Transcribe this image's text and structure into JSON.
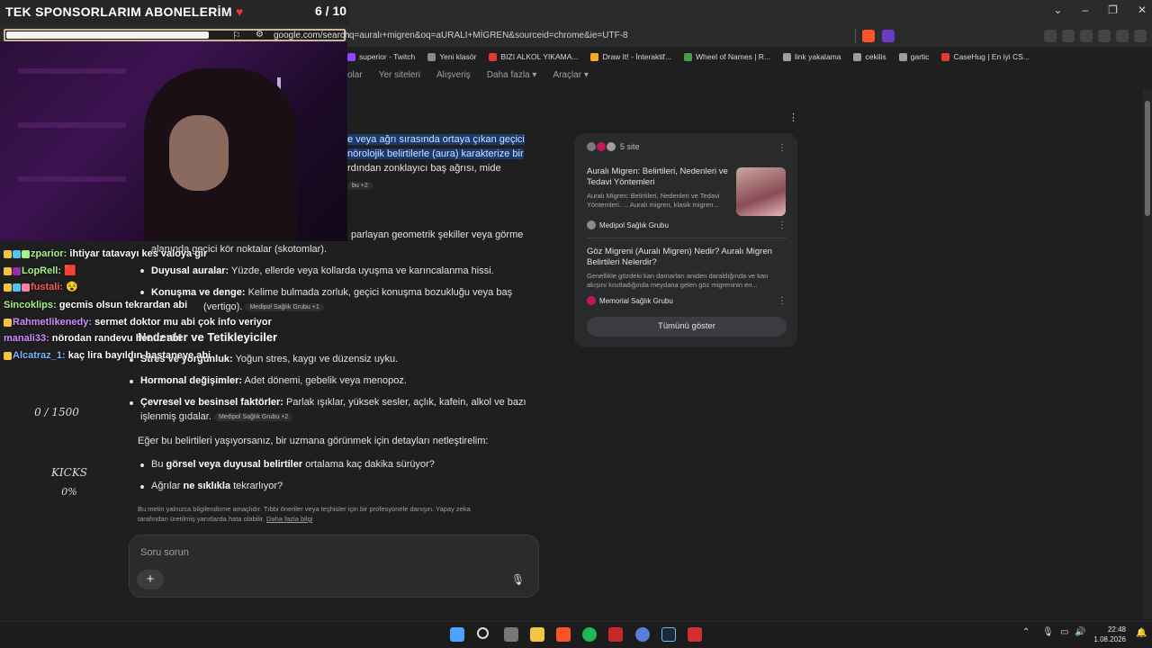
{
  "overlay": {
    "title": "TEK SPONSORLARIM ABONELERİM",
    "heart": "♥",
    "count": "6 / 10",
    "bar_url": "google.com/search",
    "goal_text": "0 / 1500",
    "kicks_label": "KICKS",
    "kicks_value": "0%"
  },
  "browser": {
    "url_rest": "q=auralı+migren&oq=aURALI+MİGREN&sourceid=chrome&ie=UTF-8",
    "bookmarks": [
      {
        "label": "superior - Twitch",
        "color": "#9146ff"
      },
      {
        "label": "Yeni klasör",
        "color": "#8a8a8a"
      },
      {
        "label": "BIZI ALKOL YIKAMA...",
        "color": "#e53935"
      },
      {
        "label": "Draw It! - İnteraktif...",
        "color": "#f9a825"
      },
      {
        "label": "Wheel of Names | R...",
        "color": "#43a047"
      },
      {
        "label": "link yakalama",
        "color": "#9e9e9e"
      },
      {
        "label": "cekilis",
        "color": "#9e9e9e"
      },
      {
        "label": "gartic",
        "color": "#9e9e9e"
      },
      {
        "label": "CaseHug | En iyi CS...",
        "color": "#e53935"
      }
    ],
    "nav": [
      "olar",
      "Yer siteleri",
      "Alışveriş",
      "Daha fazla ▾",
      "Araçlar ▾"
    ]
  },
  "chat": [
    {
      "user": "zparior:",
      "msg": " ihtiyar tatavayı kes valoya gir",
      "color": "#a6f08a"
    },
    {
      "user": "LopRell:",
      "msg": " 🟥",
      "color": "#a6f08a"
    },
    {
      "user": "fustali:",
      "msg": " 😵",
      "color": "#ff5a5a"
    },
    {
      "user": "Sincoklips:",
      "msg": " gecmis olsun tekrardan abi",
      "color": "#a6f08a"
    },
    {
      "user": "Rahmetlikenedy:",
      "msg": " sermet doktor mu abi çok info veriyor",
      "color": "#d38cff"
    },
    {
      "user": "manali33:",
      "msg": " nörodan randevu henüz abi",
      "color": "#d38cff"
    },
    {
      "user": "Alcatraz_1:",
      "msg": " kaç lira bayıldın hastaneye abi",
      "color": "#7fb2ff"
    }
  ],
  "content": {
    "p1_line1": "e veya ağrı sırasında ortaya çıkan geçici",
    "p1_line2": "nörolojik belirtilerle (aura) karakterize bir",
    "p1_line3": "rdından zonklayıcı baş ağrısı, mide",
    "chip1": "bu +2",
    "visual_line1": "parlayan geometrik şekiller veya görme",
    "visual_line2": "alanında geçici kör noktalar (skotomlar).",
    "b_sensory_bold": "Duyusal auralar:",
    "b_sensory_text": " Yüzde, ellerde veya kollarda uyuşma ve karıncalanma hissi.",
    "b_speech_bold": "Konuşma ve denge:",
    "b_speech_text": " Kelime bulmada zorluk, geçici konuşma bozukluğu veya baş",
    "b_speech_line2": "(vertigo).",
    "chip2": "Medipol Sağlık Grubu +1",
    "heading": "Nedenler ve Tetikleyiciler",
    "b_stress_bold": "Stres ve yorgunluk:",
    "b_stress_text": " Yoğun stres, kaygı ve düzensiz uyku.",
    "b_hormone_bold": "Hormonal değişimler:",
    "b_hormone_text": " Adet dönemi, gebelik veya menopoz.",
    "b_env_bold": "Çevresel ve besinsel faktörler:",
    "b_env_text": " Parlak ışıklar, yüksek sesler, açlık, kafein, alkol ve bazı",
    "b_env_line2": "işlenmiş gıdalar.",
    "chip3": "Medipol Sağlık Grubu +2",
    "followup": "Eğer bu belirtileri yaşıyorsanız, bir uzmana görünmek için detayları netleştirelim:",
    "q1_pre": "Bu ",
    "q1_bold": "görsel veya duyusal belirtiler",
    "q1_post": " ortalama kaç dakika sürüyor?",
    "q2_pre": "Ağrılar ",
    "q2_bold": "ne sıklıkla",
    "q2_post": " tekrarlıyor?",
    "disclaimer_line1": "Bu metin yalnızca bilgilendirme amaçlıdır. Tıbbi öneriler veya teşhisler için bir profesyonele danışın. Yapay zeka",
    "disclaimer_line2": "tarafından üretilmiş yanıtlarda hata olabilir.",
    "disclaimer_link": "Daha fazla bilgi"
  },
  "sources": {
    "count_label": "5 site",
    "items": [
      {
        "title_line1": "Auralı Migren: Belirtileri, Nedenleri ve",
        "title_line2": "Tedavi Yöntemleri",
        "desc_line1": "Auralı Migren: Belirtileri, Nedenleri ve Tedavi",
        "desc_line2": "Yöntemleri. ... Auralı migren, klasik migren...",
        "source": "Medipol Sağlık Grubu"
      },
      {
        "title_line1": "Göz Migreni (Auralı Migren) Nedir? Auralı Migren",
        "title_line2": "Belirtileri Nelerdir?",
        "desc_line1": "Genellikle gözdeki kan damarları aniden daraldığında ve kan",
        "desc_line2": "akışını kısıtladığında meydana gelen göz migreninin en...",
        "source": "Memorial Sağlık Grubu"
      }
    ],
    "show_all": "Tümünü göster"
  },
  "ask": {
    "placeholder": "Soru sorun",
    "plus": "+",
    "mic": "🎙"
  },
  "taskbar": {
    "time": "22:48",
    "date": "1.08.2026"
  }
}
